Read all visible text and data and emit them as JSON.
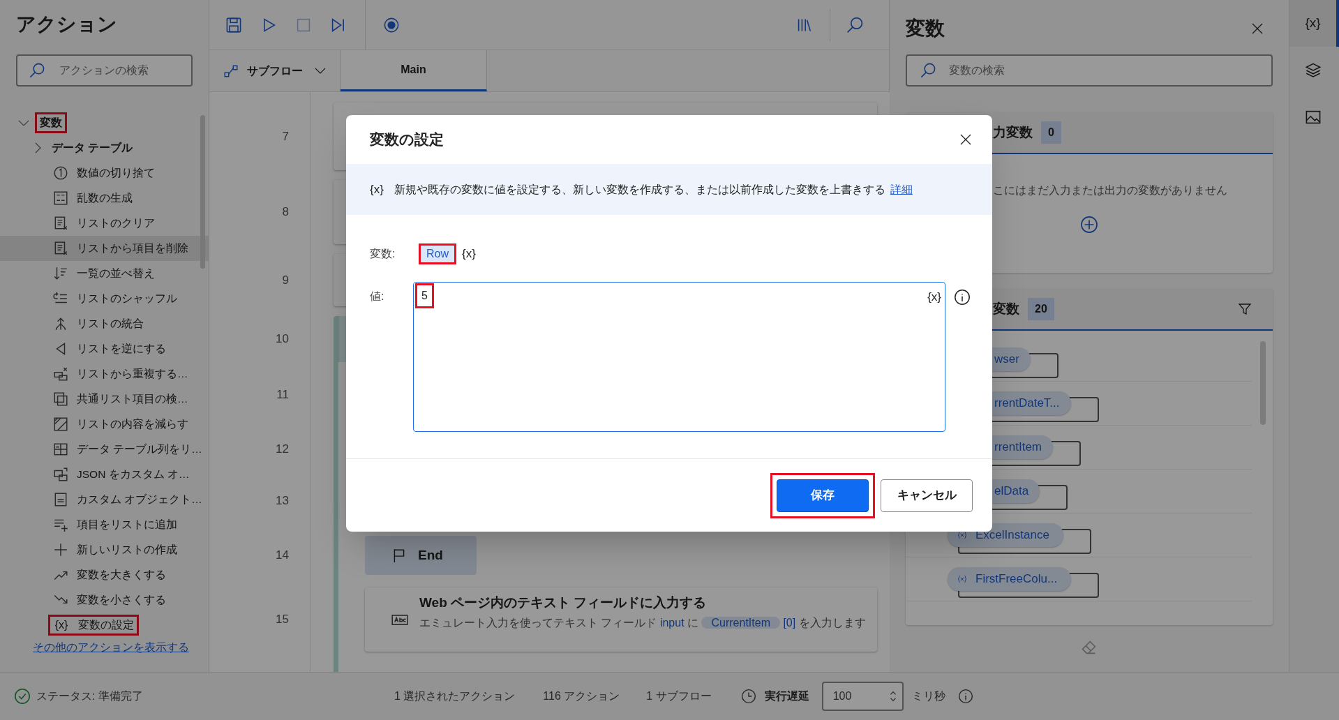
{
  "actions_panel": {
    "title": "アクション",
    "search": {
      "placeholder": "アクションの検索"
    },
    "tree": [
      {
        "label": "変数",
        "expanded": true,
        "highlighted": true,
        "children": [
          {
            "label": "データ テーブル",
            "kind": "group",
            "expanded": false,
            "hovered": false,
            "highlighted": false
          },
          {
            "label": "数値の切り捨て",
            "kind": "action",
            "hovered": false,
            "highlighted": false
          },
          {
            "label": "乱数の生成",
            "kind": "action",
            "hovered": false,
            "highlighted": false
          },
          {
            "label": "リストのクリア",
            "kind": "action",
            "hovered": false,
            "highlighted": false
          },
          {
            "label": "リストから項目を削除",
            "kind": "action",
            "hovered": true,
            "highlighted": false
          },
          {
            "label": "一覧の並べ替え",
            "kind": "action",
            "hovered": false,
            "highlighted": false
          },
          {
            "label": "リストのシャッフル",
            "kind": "action",
            "hovered": false,
            "highlighted": false
          },
          {
            "label": "リストの統合",
            "kind": "action",
            "hovered": false,
            "highlighted": false
          },
          {
            "label": "リストを逆にする",
            "kind": "action",
            "hovered": false,
            "highlighted": false
          },
          {
            "label": "リストから重複する…",
            "kind": "action",
            "hovered": false,
            "highlighted": false
          },
          {
            "label": "共通リスト項目の検…",
            "kind": "action",
            "hovered": false,
            "highlighted": false
          },
          {
            "label": "リストの内容を減らす",
            "kind": "action",
            "hovered": false,
            "highlighted": false
          },
          {
            "label": "データ テーブル列をリ…",
            "kind": "action",
            "hovered": false,
            "highlighted": false
          },
          {
            "label": "JSON をカスタム オ…",
            "kind": "action",
            "hovered": false,
            "highlighted": false
          },
          {
            "label": "カスタム オブジェクト…",
            "kind": "action",
            "hovered": false,
            "highlighted": false
          },
          {
            "label": "項目をリストに追加",
            "kind": "action",
            "hovered": false,
            "highlighted": false
          },
          {
            "label": "新しいリストの作成",
            "kind": "action",
            "hovered": false,
            "highlighted": false
          },
          {
            "label": "変数を大きくする",
            "kind": "action",
            "hovered": false,
            "highlighted": false
          },
          {
            "label": "変数を小さくする",
            "kind": "action",
            "hovered": false,
            "highlighted": false
          },
          {
            "label": "変数の設定",
            "kind": "action",
            "icon_text": "{x}",
            "hovered": false,
            "highlighted": true
          }
        ]
      }
    ],
    "more_link": "その他のアクションを表示する"
  },
  "designer": {
    "subflow_button": "サブフロー",
    "tabs": [
      {
        "label": "Main",
        "selected": true
      }
    ],
    "rows": [
      {
        "line": "7",
        "kind": "action",
        "in_group": false
      },
      {
        "line": "8",
        "kind": "action",
        "in_group": false
      },
      {
        "line": "9",
        "kind": "action",
        "in_group": false
      },
      {
        "line": "10",
        "kind": "loop",
        "in_group": false
      },
      {
        "line": "11",
        "kind": "covered"
      },
      {
        "line": "12",
        "kind": "covered"
      },
      {
        "line": "13",
        "kind": "covered"
      },
      {
        "line": "14",
        "kind": "end",
        "in_group": true,
        "label": "End"
      },
      {
        "line": "15",
        "kind": "action",
        "in_group": true,
        "title": "Web ページ内のテキスト フィールドに入力する",
        "description": [
          {
            "kind": "text",
            "text": "エミュレート入力を使ってテキスト フィールド"
          },
          {
            "kind": "link",
            "text": "input"
          },
          {
            "kind": "text",
            "text": "に"
          },
          {
            "kind": "variable",
            "text": "CurrentItem"
          },
          {
            "kind": "link",
            "text": "[0]"
          },
          {
            "kind": "text",
            "text": "を入力します"
          }
        ]
      }
    ]
  },
  "variables_panel": {
    "title": "変数",
    "search": {
      "placeholder": "変数の検索"
    },
    "io_section": {
      "title": "力変数",
      "count": "0",
      "empty_text": "こにはまだ入力または出力の変数がありません"
    },
    "flow_section": {
      "title": "変数",
      "count": "20",
      "items": [
        {
          "name": "wser",
          "covered": true
        },
        {
          "name": "rrentDateT...",
          "covered": true
        },
        {
          "name": "rrentItem",
          "covered": true
        },
        {
          "name": "elData",
          "covered": true
        },
        {
          "name": "ExcelInstance",
          "covered": false
        },
        {
          "name": "FirstFreeColu...",
          "covered": false
        }
      ]
    }
  },
  "side_tabs": [
    {
      "kind": "text",
      "label": "{x}",
      "selected": true
    },
    {
      "kind": "layers",
      "selected": false
    },
    {
      "kind": "image",
      "selected": false
    }
  ],
  "status_bar": {
    "status": "ステータス: 準備完了",
    "selected_actions": "1 選択されたアクション",
    "action_count": "116 アクション",
    "subflow_count": "1 サブフロー",
    "delay_label": "実行遅延",
    "delay_value": "100",
    "delay_unit": "ミリ秒"
  },
  "dialog": {
    "title": "変数の設定",
    "info": {
      "icon_text": "{x}",
      "text": "新規や既存の変数に値を設定する、新しい変数を作成する、または以前作成した変数を上書きする",
      "link": "詳細"
    },
    "variable": {
      "label": "変数:",
      "token": "Row",
      "highlighted": true,
      "picker": "{x}"
    },
    "value": {
      "label": "値:",
      "value": "5",
      "highlighted": true,
      "picker": "{x}"
    },
    "buttons": [
      {
        "label": "保存",
        "kind": "primary",
        "highlighted": true
      },
      {
        "label": "キャンセル",
        "kind": "secondary",
        "highlighted": false
      }
    ]
  }
}
